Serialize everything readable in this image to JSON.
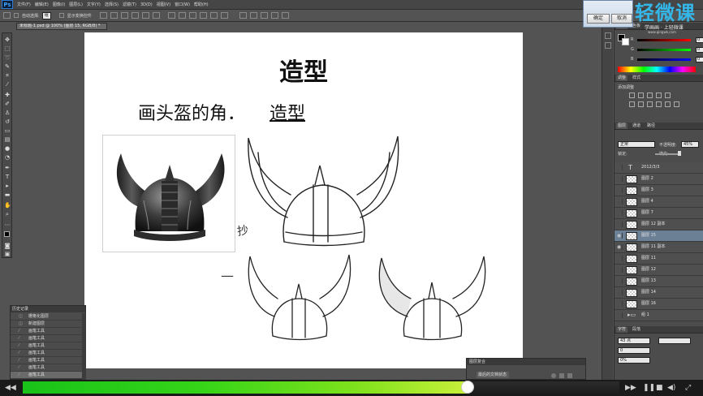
{
  "menubar": {
    "logo": "Ps",
    "items": [
      "文件(F)",
      "编辑(E)",
      "图像(I)",
      "图层(L)",
      "文字(Y)",
      "选择(S)",
      "滤镜(T)",
      "3D(D)",
      "视图(V)",
      "窗口(W)",
      "帮助(H)"
    ],
    "minimize": "–",
    "maximize": "□",
    "close": "×"
  },
  "options": {
    "feather_label": "自动选择:",
    "feather_value": "组",
    "transform_label": "显示变换控件"
  },
  "document": {
    "tab_title": "未标题-1.psd @ 100% (图层 15, RGB/8) *"
  },
  "slide": {
    "title": "造型",
    "subtitle_a": "画头盔的角．",
    "subtitle_b": "造型",
    "annotation_copy": "抄",
    "annotation_dash": "—"
  },
  "player": {
    "progress": 0.745,
    "time_current": "",
    "time_total": ""
  },
  "history_panel": {
    "title": "历史记录",
    "items": [
      "栅格化图层",
      "新建图层",
      "画笔工具",
      "画笔工具",
      "画笔工具",
      "画笔工具",
      "画笔工具",
      "画笔工具",
      "画笔工具",
      "画笔工具"
    ]
  },
  "color_panel": {
    "tabs": [
      "颜色",
      "色板"
    ],
    "r_label": "R",
    "g_label": "G",
    "b_label": "B",
    "r_value": "0",
    "g_value": "0",
    "b_value": "0"
  },
  "adjust_panel": {
    "tabs": [
      "调整",
      "样式"
    ],
    "label": "添加调整"
  },
  "layers_panel": {
    "tabs": [
      "图层",
      "通道",
      "路径"
    ],
    "blend_mode": "正常",
    "opacity_label": "不透明度:",
    "opacity_value": "45%",
    "lock_label": "锁定:",
    "fill_label": "填充:",
    "layers": [
      {
        "name": "2012/3/3",
        "type": "text",
        "selected": false
      },
      {
        "name": "图层 2",
        "type": "pixel",
        "selected": false
      },
      {
        "name": "图层 3",
        "type": "pixel",
        "selected": false
      },
      {
        "name": "图层 4",
        "type": "pixel",
        "selected": false
      },
      {
        "name": "图层 7",
        "type": "pixel",
        "selected": false
      },
      {
        "name": "图层 12 副本",
        "type": "pixel",
        "selected": false
      },
      {
        "name": "图层 15",
        "type": "pixel",
        "selected": true
      },
      {
        "name": "图层 11 副本",
        "type": "pixel",
        "selected": false
      },
      {
        "name": "图层 11",
        "type": "pixel",
        "selected": false
      },
      {
        "name": "图层 12",
        "type": "pixel",
        "selected": false
      },
      {
        "name": "图层 13",
        "type": "pixel",
        "selected": false
      },
      {
        "name": "图层 14",
        "type": "pixel",
        "selected": false
      },
      {
        "name": "图层 16",
        "type": "pixel",
        "selected": false
      },
      {
        "name": "组 1",
        "type": "group",
        "selected": false
      }
    ]
  },
  "char_panel": {
    "tabs": [
      "字符",
      "段落"
    ],
    "font_size": "43 点",
    "leading": "0",
    "tracking": "0%"
  },
  "minipanel": {
    "title": "图层复合",
    "label": "最后的文档状态"
  },
  "watermark": {
    "dialog_btn1": "确定",
    "dialog_btn2": "取消",
    "brand": "轻微课",
    "sub": "学画画 · 上轻微课",
    "url": "www.qingwk.com"
  },
  "colors": {
    "progress_start": "#19c219",
    "progress_end": "#c9f03a",
    "brand_blue": "#34b7e8",
    "selected_layer": "#6b7f95"
  }
}
